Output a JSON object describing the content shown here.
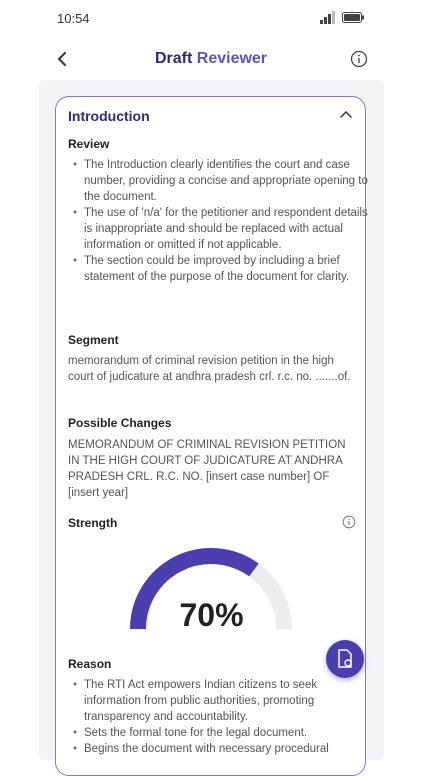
{
  "status": {
    "time": "10:54"
  },
  "header": {
    "title_part1": "Draft",
    "title_part2": "Reviewer"
  },
  "section": {
    "title": "Introduction",
    "review_heading": "Review",
    "review_points": [
      "The Introduction clearly identifies the court and case number, providing a concise and appropriate opening to the document.",
      "The use of 'n/a' for the petitioner and respondent details is inappropriate and should be replaced with actual information or omitted if not applicable.",
      "The section could be improved by including a brief statement of the purpose of the document for clarity."
    ],
    "segment_heading": "Segment",
    "segment_text": "memorandum of criminal revision petition in the high court of judicature at andhra pradesh crl. r.c. no. .......of.",
    "changes_heading": "Possible Changes",
    "changes_text": "MEMORANDUM OF CRIMINAL REVISION PETITION IN THE HIGH COURT OF JUDICATURE AT ANDHRA PRADESH CRL. R.C. NO. [insert case number] OF [insert year]",
    "strength_heading": "Strength",
    "strength_value": 0.7,
    "strength_label": "70%",
    "reason_heading": "Reason",
    "reason_points": [
      "The RTI Act empowers Indian citizens to seek information from public authorities, promoting transparency and accountability.",
      "Sets the formal tone for the legal document.",
      "Begins the document with necessary procedural"
    ]
  },
  "colors": {
    "accent": "#4b3fb0",
    "card_border": "#7f77cf",
    "gauge_track": "#eeeeee"
  }
}
